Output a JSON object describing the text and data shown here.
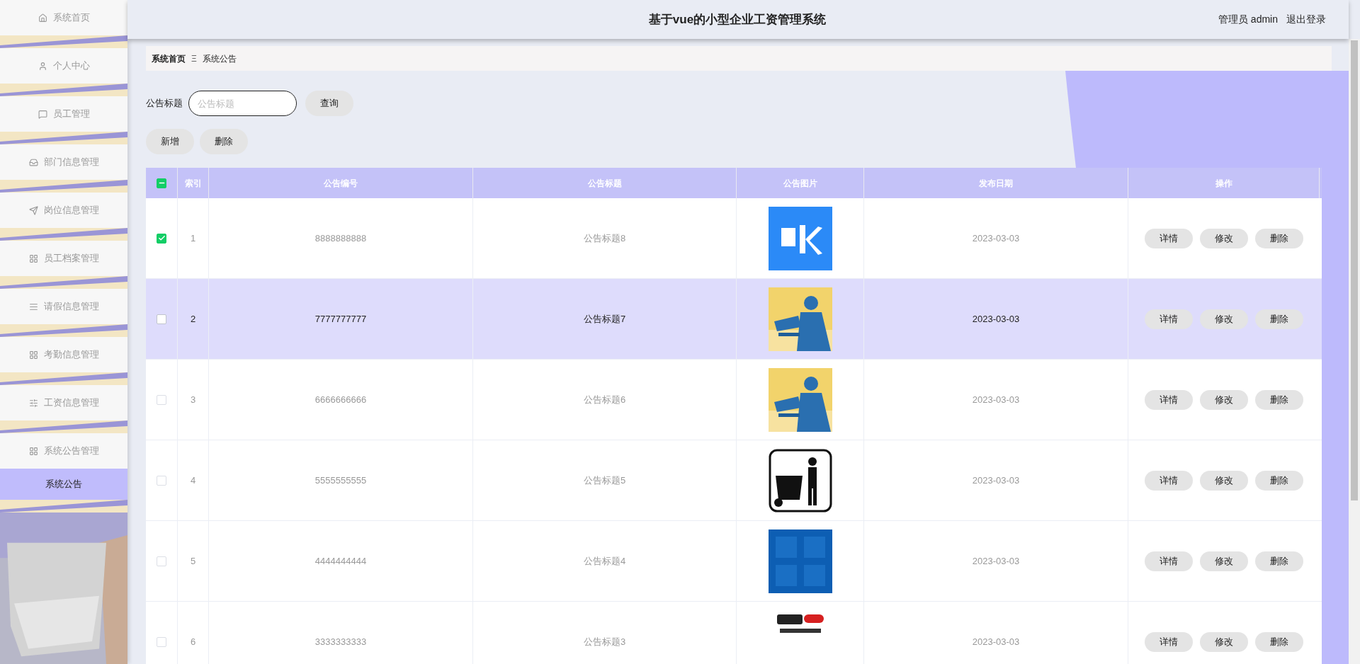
{
  "header": {
    "title": "基于vue的小型企业工资管理系统",
    "user": "管理员 admin",
    "logout": "退出登录"
  },
  "sidebar": {
    "items": [
      {
        "label": "系统首页"
      },
      {
        "label": "个人中心"
      },
      {
        "label": "员工管理"
      },
      {
        "label": "部门信息管理"
      },
      {
        "label": "岗位信息管理"
      },
      {
        "label": "员工档案管理"
      },
      {
        "label": "请假信息管理"
      },
      {
        "label": "考勤信息管理"
      },
      {
        "label": "工资信息管理"
      },
      {
        "label": "系统公告管理",
        "children": [
          {
            "label": "系统公告",
            "selected": true
          }
        ]
      }
    ]
  },
  "breadcrumb": {
    "items": [
      "系统首页",
      "系统公告"
    ],
    "separator": "Ξ"
  },
  "search": {
    "label": "公告标题",
    "placeholder": "公告标题",
    "button": "查询"
  },
  "actions": [
    "新增",
    "删除"
  ],
  "table": {
    "select_all": {
      "indeterminate": true
    },
    "columns": [
      "索引",
      "公告编号",
      "公告标题",
      "公告图片",
      "发布日期",
      "操作"
    ],
    "rows": [
      {
        "index": "1",
        "number": "8888888888",
        "title": "公告标题8",
        "date": "2023-03-03",
        "checked": true,
        "highlighted": false,
        "buttons": [
          "详情",
          "修改",
          "删除"
        ]
      },
      {
        "index": "2",
        "number": "7777777777",
        "title": "公告标题7",
        "date": "2023-03-03",
        "checked": false,
        "highlighted": true,
        "buttons": [
          "详情",
          "修改",
          "删除"
        ]
      },
      {
        "index": "3",
        "number": "6666666666",
        "title": "公告标题6",
        "date": "2023-03-03",
        "checked": false,
        "highlighted": false,
        "buttons": [
          "详情",
          "修改",
          "删除"
        ]
      },
      {
        "index": "4",
        "number": "5555555555",
        "title": "公告标题5",
        "date": "2023-03-03",
        "checked": false,
        "highlighted": false,
        "buttons": [
          "详情",
          "修改",
          "删除"
        ]
      },
      {
        "index": "5",
        "number": "4444444444",
        "title": "公告标题4",
        "date": "2023-03-03",
        "checked": false,
        "highlighted": false,
        "buttons": [
          "详情",
          "修改",
          "删除"
        ]
      },
      {
        "index": "6",
        "number": "3333333333",
        "title": "公告标题3",
        "date": "2023-03-03",
        "checked": false,
        "highlighted": false,
        "buttons": [
          "详情",
          "修改",
          "删除"
        ]
      }
    ]
  }
}
